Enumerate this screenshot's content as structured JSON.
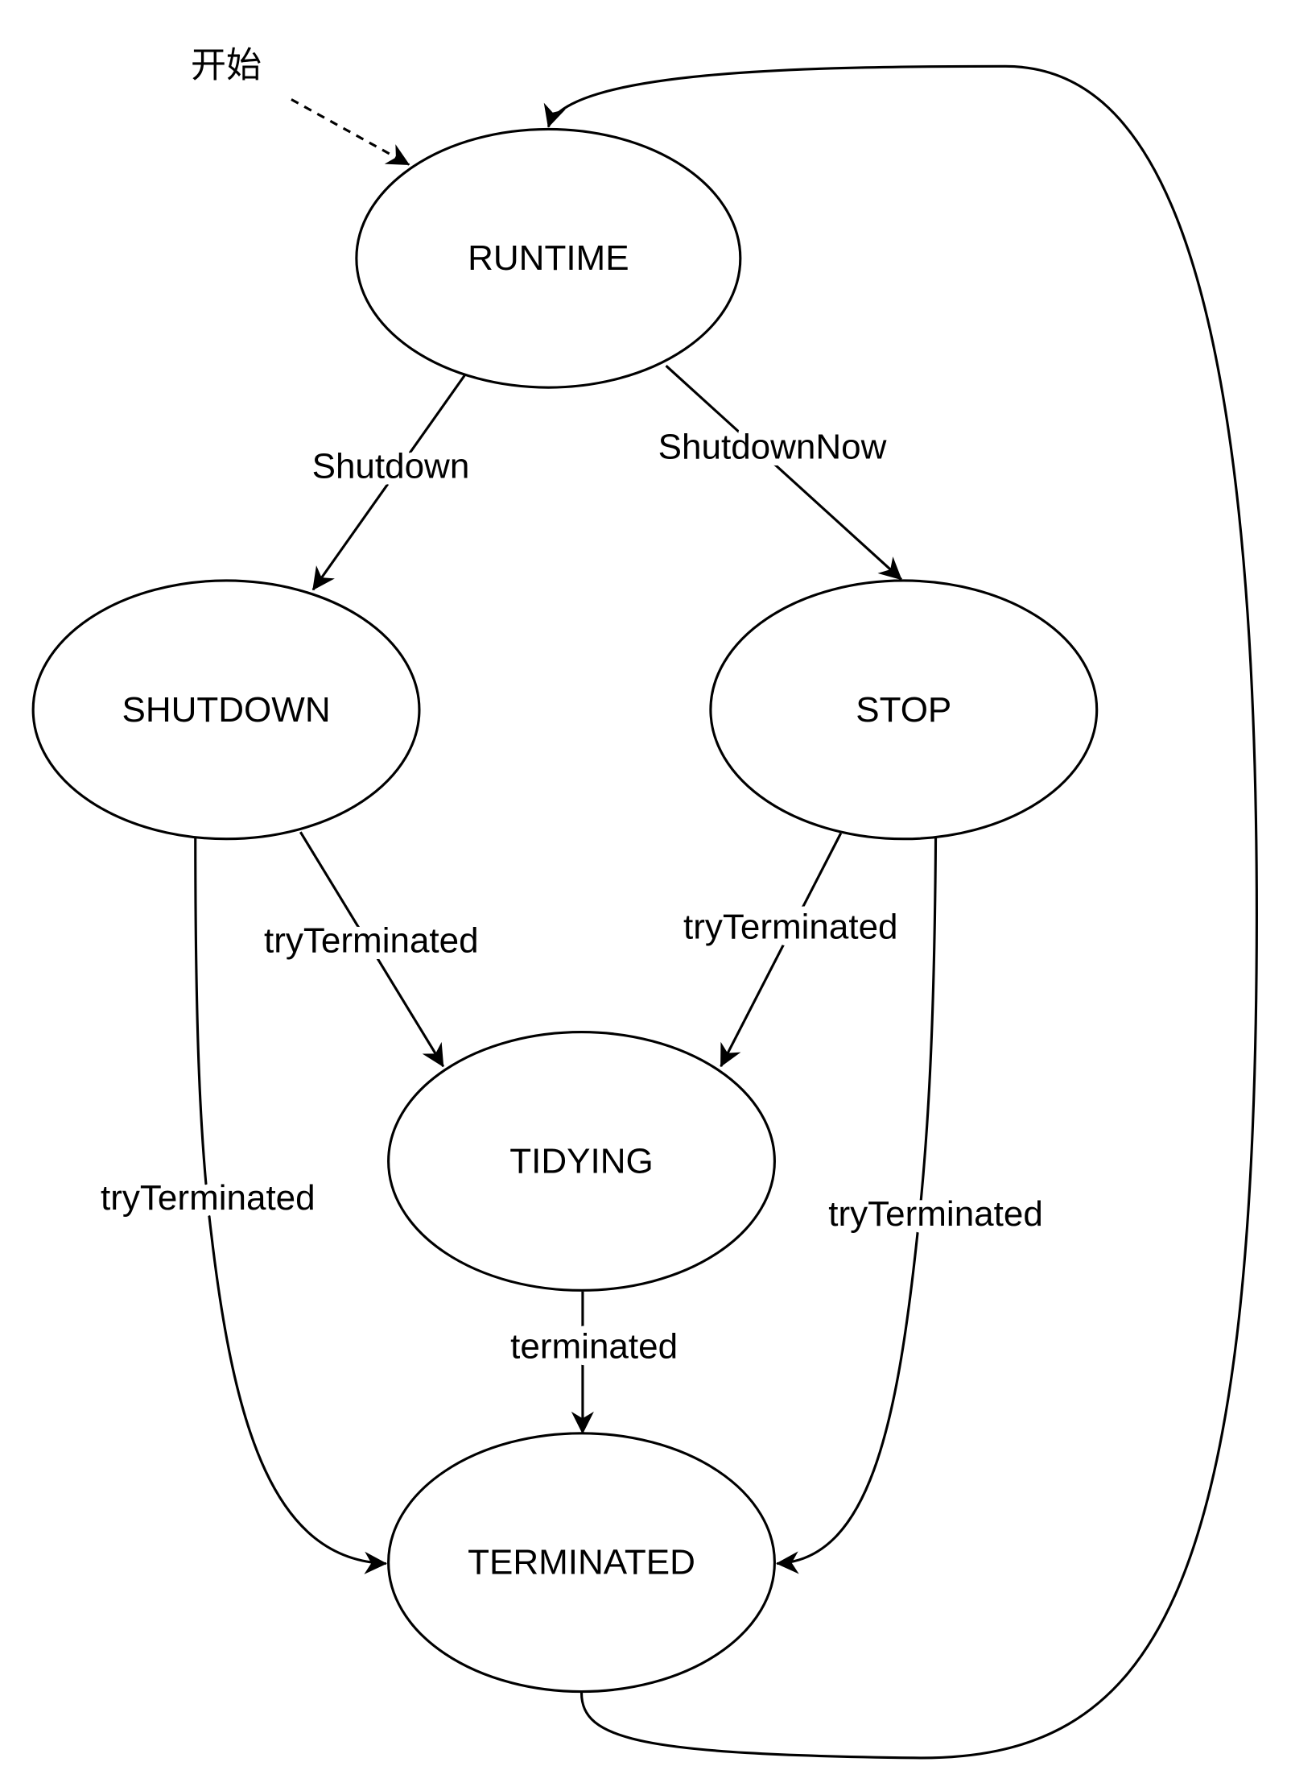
{
  "start_label": "开始",
  "states": {
    "runtime": "RUNTIME",
    "shutdown": "SHUTDOWN",
    "stop": "STOP",
    "tidying": "TIDYING",
    "terminated": "TERMINATED"
  },
  "transitions": {
    "runtime_to_shutdown": "Shutdown",
    "runtime_to_stop": "ShutdownNow",
    "shutdown_to_tidying": "tryTerminated",
    "stop_to_tidying": "tryTerminated",
    "shutdown_to_terminated": "tryTerminated",
    "stop_to_terminated": "tryTerminated",
    "tidying_to_terminated": "terminated"
  },
  "colors": {
    "stroke": "#000000",
    "fill": "#ffffff"
  }
}
